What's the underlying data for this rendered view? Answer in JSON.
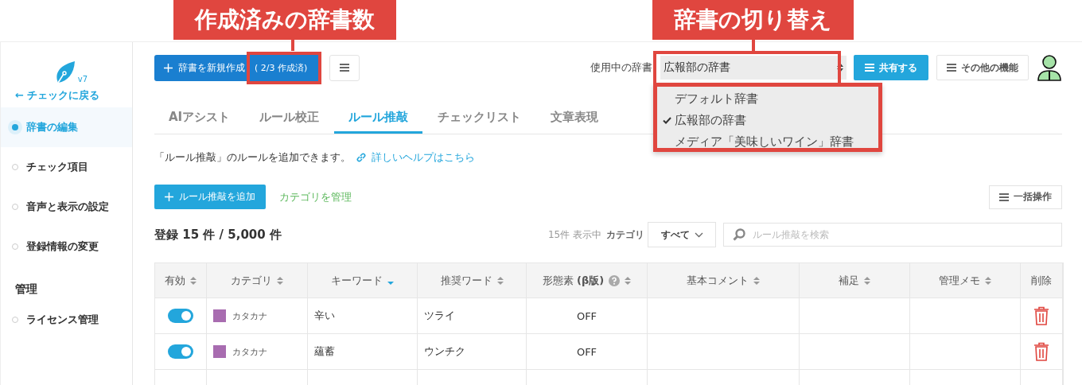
{
  "callouts": [
    {
      "text": "作成済みの辞書数"
    },
    {
      "text": "辞書の切り替え"
    }
  ],
  "sidebar": {
    "version": "v7",
    "back_link": "← チェックに戻る",
    "items": [
      {
        "label": "辞書の編集",
        "selected": true
      },
      {
        "label": "チェック項目",
        "selected": false
      },
      {
        "label": "音声と表示の設定",
        "selected": false
      },
      {
        "label": "登録情報の変更",
        "selected": false
      }
    ],
    "section": "管理",
    "section_items": [
      {
        "label": "ライセンス管理",
        "selected": false
      }
    ]
  },
  "toolbar": {
    "new_button": "辞書を新規作成",
    "created_count": "( 2/3 作成済)",
    "dictionary_label": "使用中の辞書",
    "dictionary_select": "広報部の辞書",
    "share_button": "共有する",
    "more_button": "その他の機能"
  },
  "dictionary_options": [
    {
      "label": "デフォルト辞書",
      "selected": false
    },
    {
      "label": "広報部の辞書",
      "selected": true
    },
    {
      "label": "メディア「美味しいワイン」辞書",
      "selected": false
    }
  ],
  "tabs": [
    {
      "label": "AIアシスト",
      "selected": false
    },
    {
      "label": "ルール校正",
      "selected": false
    },
    {
      "label": "ルール推敲",
      "selected": true
    },
    {
      "label": "チェックリスト",
      "selected": false
    },
    {
      "label": "文章表現",
      "selected": false
    }
  ],
  "description": "「ルール推敲」のルールを追加できます。",
  "help_link": "詳しいヘルプはこちら",
  "add_button": "ルール推敲を追加",
  "manage_categories": "カテゴリを管理",
  "bulk_button": "一括操作",
  "total": "登録 15 件 / 5,000 件",
  "showing": "15件 表示中",
  "category_label": "カテゴリ",
  "category_filter": "すべて",
  "search": {
    "placeholder": "ルール推敲を検索"
  },
  "table": {
    "columns": [
      {
        "label": "有効",
        "sortable": true,
        "sorted": false
      },
      {
        "label": "カテゴリ",
        "sortable": true,
        "sorted": false
      },
      {
        "label": "キーワード",
        "sortable": true,
        "sorted": true
      },
      {
        "label": "推奨ワード",
        "sortable": true,
        "sorted": false
      },
      {
        "label": "形態素 **(β版)**",
        "sortable": true,
        "sorted": false,
        "help": true
      },
      {
        "label": "基本コメント",
        "sortable": true,
        "sorted": false
      },
      {
        "label": "補足",
        "sortable": true,
        "sorted": false
      },
      {
        "label": "管理メモ",
        "sortable": true,
        "sorted": false
      },
      {
        "label": "削除",
        "sortable": false
      }
    ],
    "rows": [
      {
        "enabled": true,
        "category": "カタカナ",
        "color": "#a86cb0",
        "keyword": "辛い",
        "recommended": "ツライ",
        "morph": "OFF"
      },
      {
        "enabled": true,
        "category": "カタカナ",
        "color": "#a86cb0",
        "keyword": "蘊蓄",
        "recommended": "ウンチク",
        "morph": "OFF"
      }
    ]
  }
}
